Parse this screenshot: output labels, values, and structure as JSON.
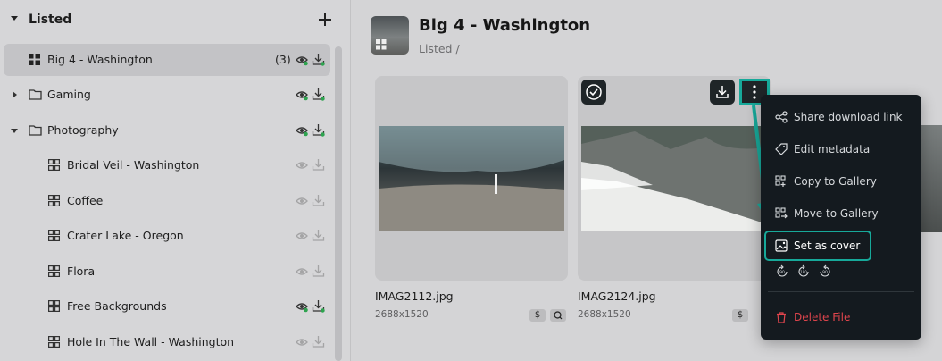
{
  "sidebar": {
    "title": "Listed",
    "items": [
      {
        "label": "Big 4 - Washington",
        "count": "(3)"
      },
      {
        "label": "Gaming"
      },
      {
        "label": "Photography"
      },
      {
        "label": "Bridal Veil - Washington"
      },
      {
        "label": "Coffee"
      },
      {
        "label": "Crater Lake - Oregon"
      },
      {
        "label": "Flora"
      },
      {
        "label": "Free Backgrounds"
      },
      {
        "label": "Hole In The Wall - Washington"
      }
    ]
  },
  "header": {
    "title": "Big 4 - Washington",
    "breadcrumb": "Listed /"
  },
  "cards": [
    {
      "filename": "IMAG2112.jpg",
      "dimensions": "2688x1520",
      "tag_price": "$"
    },
    {
      "filename": "IMAG2124.jpg",
      "dimensions": "2688x1520",
      "tag_price": "$"
    }
  ],
  "menu": {
    "items": [
      {
        "label": "Share download link",
        "icon": "share-icon"
      },
      {
        "label": "Edit metadata",
        "icon": "tag-icon"
      },
      {
        "label": "Copy to Gallery",
        "icon": "copy-gallery-icon"
      },
      {
        "label": "Move to Gallery",
        "icon": "move-gallery-icon"
      },
      {
        "label": "Set as cover",
        "icon": "image-icon"
      }
    ],
    "rotate_labels": [
      "90",
      "180",
      "90"
    ],
    "delete_label": "Delete File"
  },
  "colors": {
    "accent": "#17a99a",
    "menu_bg": "#141a1f",
    "danger": "#e0454d"
  }
}
